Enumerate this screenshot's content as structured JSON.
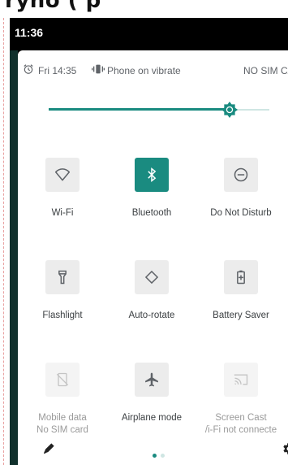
{
  "status_bar": {
    "time": "11:36"
  },
  "info": {
    "alarm_time": "Fri 14:35",
    "vibrate": "Phone on vibrate",
    "sim": "NO SIM CAR"
  },
  "brightness": {
    "level": 0.82
  },
  "tiles": [
    {
      "label": "Wi-Fi",
      "sublabel": "",
      "icon": "wifi-icon",
      "state": "off"
    },
    {
      "label": "Bluetooth",
      "sublabel": "",
      "icon": "bluetooth-icon",
      "state": "on"
    },
    {
      "label": "Do Not Disturb",
      "sublabel": "",
      "icon": "do-not-disturb-icon",
      "state": "off"
    },
    {
      "label": "Flashlight",
      "sublabel": "",
      "icon": "flashlight-icon",
      "state": "off"
    },
    {
      "label": "Auto-rotate",
      "sublabel": "",
      "icon": "auto-rotate-icon",
      "state": "off"
    },
    {
      "label": "Battery Saver",
      "sublabel": "",
      "icon": "battery-saver-icon",
      "state": "off"
    },
    {
      "label": "Mobile data",
      "sublabel": "No SIM card",
      "icon": "mobile-data-off-icon",
      "state": "disabled"
    },
    {
      "label": "Airplane mode",
      "sublabel": "",
      "icon": "airplane-icon",
      "state": "off"
    },
    {
      "label": "Screen Cast",
      "sublabel": "/i-Fi not connecte",
      "icon": "cast-icon",
      "state": "disabled"
    }
  ],
  "pager": {
    "pages": 2,
    "current": 0
  },
  "colors": {
    "accent": "#1a8b80",
    "track": "#cfe6e3"
  }
}
